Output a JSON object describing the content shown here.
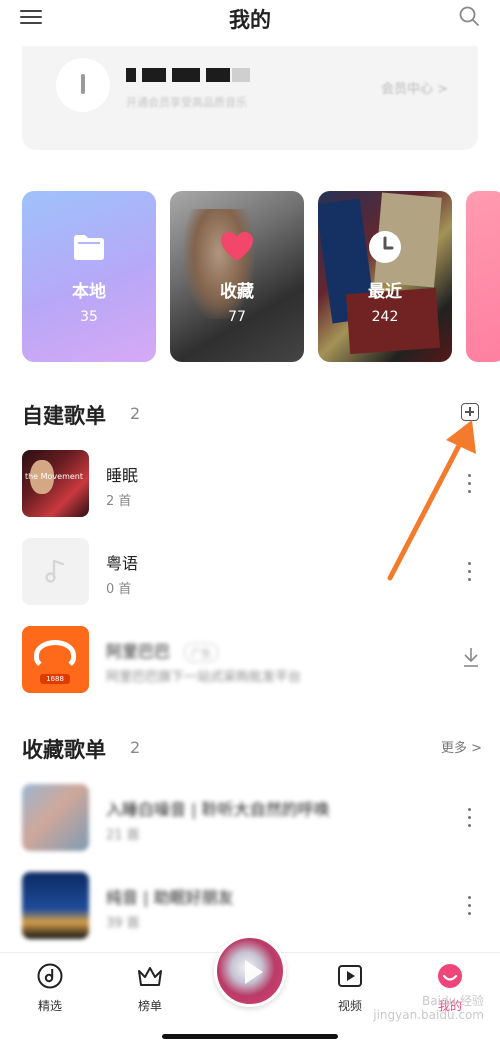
{
  "header": {
    "title": "我的"
  },
  "member": {
    "subtitle": "开通会员享受高品质音乐",
    "center_label": "会员中心 >"
  },
  "categories": [
    {
      "label": "本地",
      "count": "35",
      "icon": "folder-icon"
    },
    {
      "label": "收藏",
      "count": "77",
      "icon": "heart-icon"
    },
    {
      "label": "最近",
      "count": "242",
      "icon": "clock-icon"
    }
  ],
  "self_playlists": {
    "title": "自建歌单",
    "count": "2",
    "items": [
      {
        "title": "睡眠",
        "sub": "2 首"
      },
      {
        "title": "粤语",
        "sub": "0 首"
      },
      {
        "title": "阿里巴巴",
        "tag": "广告",
        "sub": "阿里巴巴旗下一站式采购批发平台"
      }
    ]
  },
  "fav_playlists": {
    "title": "收藏歌单",
    "count": "2",
    "more": "更多 >",
    "items": [
      {
        "title": "入睡白噪音 | 聆听大自然的呼唤",
        "sub": "21 首"
      },
      {
        "title": "纯音 | 助眠好朋友",
        "sub": "39 首"
      }
    ]
  },
  "tabs": [
    {
      "label": "精选",
      "icon": "disc-icon"
    },
    {
      "label": "榜单",
      "icon": "crown-icon"
    },
    {
      "label": "视频",
      "icon": "video-icon"
    },
    {
      "label": "我的",
      "icon": "smile-icon"
    }
  ],
  "thumb_text": {
    "sleep": "the Movement"
  },
  "ali_badge": "1688",
  "watermark": {
    "line1": "Baidu 经验",
    "line2": "jingyan.baidu.com"
  },
  "colors": {
    "accent": "#f0457a",
    "annotation_arrow": "#f47b2b"
  }
}
